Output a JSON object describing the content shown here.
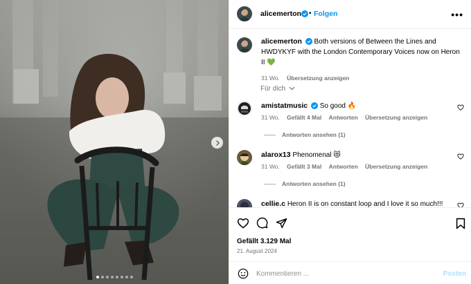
{
  "post": {
    "author": "alicemerton",
    "follow_label": "Folgen",
    "separator": "•",
    "more_label": "•••",
    "caption": "Both versions of Between the Lines and HWDYKYF with the London Contemporary Voices now on Heron II 💚",
    "caption_time": "31 Wo.",
    "translate_label": "Übersetzung anzeigen",
    "filter_label": "Für dich",
    "likes": "Gefällt 3.129 Mal",
    "date": "21. August 2024",
    "carousel_count": 8,
    "carousel_active": 0
  },
  "comments": [
    {
      "user": "amistatmusic",
      "verified": true,
      "text": "So good 🔥",
      "time": "31 Wo.",
      "likes": "Gefällt 4 Mal",
      "reply": "Antworten",
      "translate": "Übersetzung anzeigen",
      "replies": "Antworten ansehen (1)"
    },
    {
      "user": "alarox13",
      "verified": false,
      "text": "Phenomenal 😻",
      "time": "31 Wo.",
      "likes": "Gefällt 3 Mal",
      "reply": "Antworten",
      "translate": "Übersetzung anzeigen",
      "replies": "Antworten ansehen (1)"
    },
    {
      "user": "cellie.c",
      "verified": false,
      "text": "Heron II is on constant loop and I love it so much!!!"
    }
  ],
  "composer": {
    "placeholder": "Kommentieren ...",
    "post_label": "Posten"
  },
  "colors": {
    "accent": "#0095f6",
    "verified": "#0095f6",
    "muted_text": "#737373",
    "post_button_disabled": "#b2dffc"
  },
  "icons": [
    "verified-badge-icon",
    "more-options-icon",
    "chevron-down-icon",
    "heart-icon",
    "comment-icon",
    "share-icon",
    "bookmark-icon",
    "emoji-icon",
    "chevron-right-icon"
  ]
}
